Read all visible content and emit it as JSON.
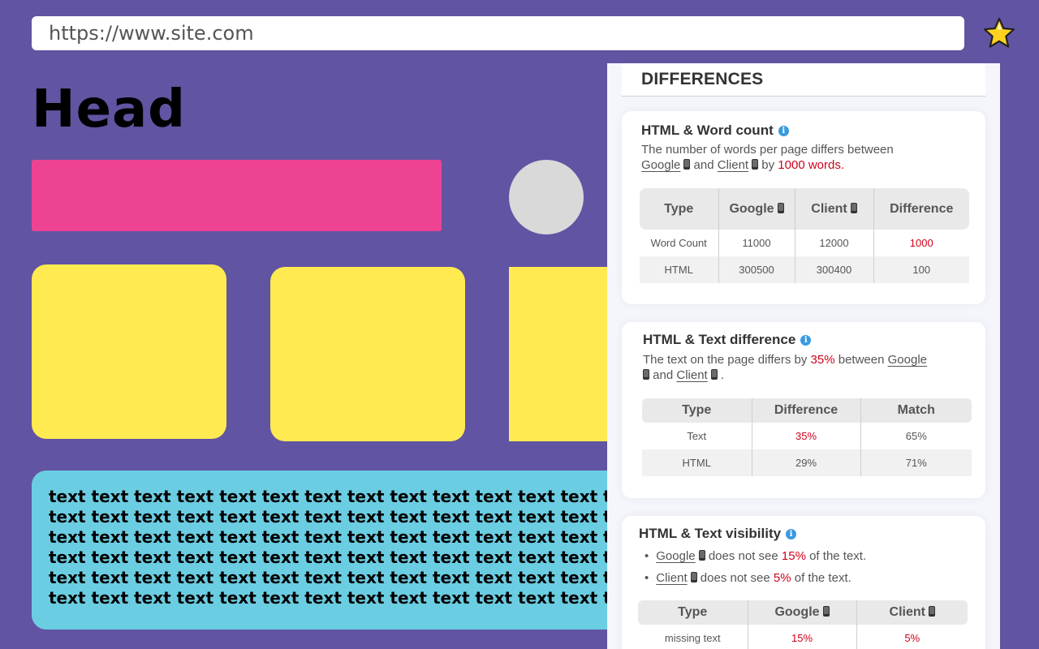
{
  "browser": {
    "url": "https://www.site.com",
    "bookmark_icon": "star-icon"
  },
  "page": {
    "heading": "Head",
    "text_block": "text text text text text text text text text text text text text text text text"
  },
  "colors": {
    "background": "#6154a2",
    "pink": "#ee4392",
    "yellow": "#ffea52",
    "cyan": "#6bcde2",
    "accent_red": "#d0021b",
    "info_blue": "#3a9ae0"
  },
  "panel": {
    "title": "DIFFERENCES",
    "word_count": {
      "title": "HTML & Word count",
      "desc_1": "The number of words per page differs between",
      "google": "Google",
      "and": "and",
      "client": "Client",
      "by": "by",
      "amount": "1000 words.",
      "headers": [
        "Type",
        "Google",
        "Client",
        "Difference"
      ],
      "rows": [
        [
          "Word Count",
          "11000",
          "12000",
          "1000"
        ],
        [
          "HTML",
          "300500",
          "300400",
          "100"
        ]
      ]
    },
    "text_difference": {
      "title": "HTML & Text difference",
      "desc_1": "The text on the page differs by",
      "pct": "35%",
      "between": "between",
      "google": "Google",
      "and": "and",
      "client": "Client",
      "end": ".",
      "headers": [
        "Type",
        "Difference",
        "Match"
      ],
      "rows": [
        [
          "Text",
          "35%",
          "65%"
        ],
        [
          "HTML",
          "29%",
          "71%"
        ]
      ]
    },
    "text_visibility": {
      "title": "HTML & Text visibility",
      "google": "Google",
      "client": "Client",
      "does_not_see": "does not see",
      "of_text": "of the text.",
      "google_pct": "15%",
      "client_pct": "5%",
      "headers": [
        "Type",
        "Google",
        "Client"
      ],
      "rows": [
        [
          "missing text",
          "15%",
          "5%"
        ]
      ]
    }
  }
}
